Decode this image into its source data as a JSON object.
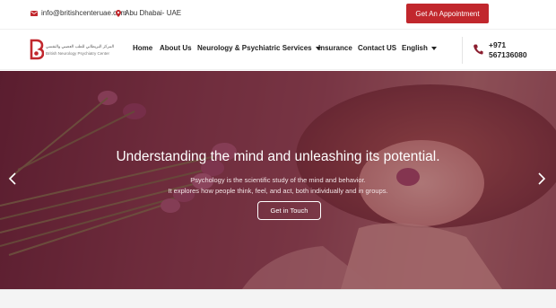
{
  "topbar": {
    "email": "info@britishcenteruae.com",
    "location": "Abu Dhabai- UAE",
    "appointment_label": "Get An Appointment"
  },
  "logo": {
    "arabic_text": "المركز البريطاني للطب العصبي والنفسي",
    "english_text": "British Neurology Psychiatry Center"
  },
  "nav": {
    "items": [
      {
        "label": "Home"
      },
      {
        "label": "About Us"
      },
      {
        "label": "Neurology & Psychiatric Services"
      },
      {
        "label": "Insurance"
      },
      {
        "label": "Contact US"
      },
      {
        "label": "English"
      }
    ],
    "phone_line1": "+971",
    "phone_line2": "567136080"
  },
  "hero": {
    "title": "Understanding the mind and unleashing its potential.",
    "subtitle_line1": "Psychology is the scientific study of the mind and behavior.",
    "subtitle_line2": "It explores how people think, feel, and act, both individually and in groups.",
    "cta_label": "Get in Touch"
  },
  "colors": {
    "brand_red": "#c1272d",
    "hero_overlay": "#5a192d"
  },
  "icons": [
    "mail-icon",
    "location-pin-icon",
    "phone-icon",
    "chevron-left-icon",
    "chevron-right-icon"
  ]
}
